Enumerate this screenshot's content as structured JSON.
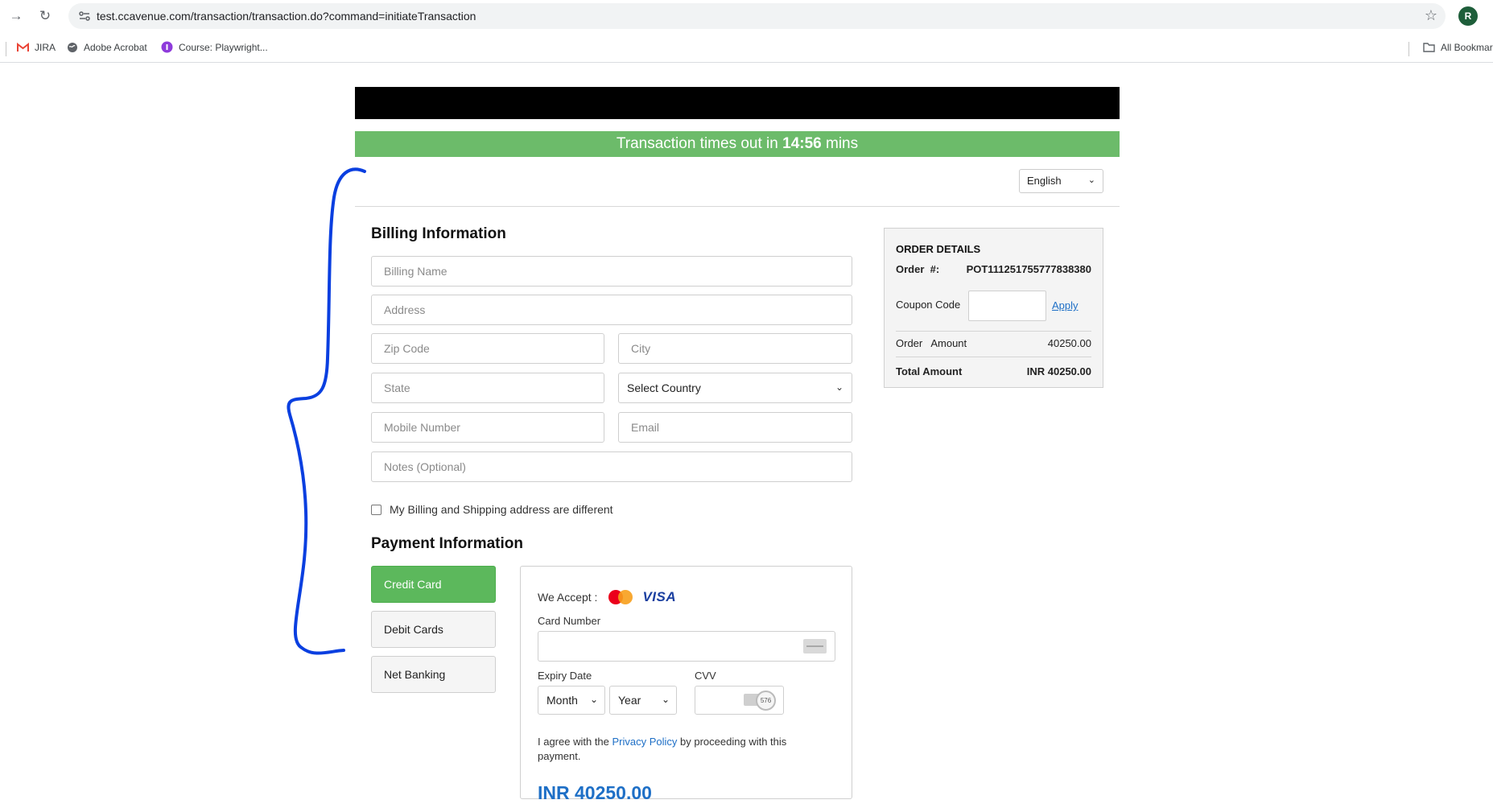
{
  "browser": {
    "url": "test.ccavenue.com/transaction/transaction.do?command=initiateTransaction",
    "profile_initial": "R",
    "bookmarks": [
      {
        "label": "JIRA",
        "icon": "gmail-icon"
      },
      {
        "label": "Adobe Acrobat",
        "icon": "globe-icon"
      },
      {
        "label": "Course: Playwright...",
        "icon": "course-icon"
      }
    ],
    "all_bookmarks_label": "All Bookmarks"
  },
  "timer": {
    "prefix": "Transaction times out in ",
    "time": "14:56",
    "suffix": " mins"
  },
  "language": {
    "selected": "English"
  },
  "billing": {
    "title": "Billing Information",
    "name_placeholder": "Billing Name",
    "address_placeholder": "Address",
    "zip_placeholder": "Zip Code",
    "city_placeholder": "City",
    "state_placeholder": "State",
    "country_selected": "Select Country",
    "mobile_placeholder": "Mobile Number",
    "email_placeholder": "Email",
    "notes_placeholder": "Notes (Optional)",
    "different_address_label": "My Billing and Shipping address are different"
  },
  "payment": {
    "title": "Payment Information",
    "tabs": [
      {
        "label": "Credit Card",
        "active": true
      },
      {
        "label": "Debit Cards",
        "active": false
      },
      {
        "label": "Net Banking",
        "active": false
      }
    ],
    "we_accept_label": "We Accept :",
    "visa_label": "VISA",
    "card_number_label": "Card Number",
    "expiry_label": "Expiry Date",
    "month_selected": "Month",
    "year_selected": "Year",
    "cvv_label": "CVV",
    "cvv_sample": "576",
    "agree_prefix": "I agree with the ",
    "privacy_link": "Privacy Policy",
    "agree_suffix": " by proceeding with this payment.",
    "amount": "INR 40250.00"
  },
  "order": {
    "title": "ORDER DETAILS",
    "order_no_label": "Order  #:",
    "order_no": "POT111251755777838380",
    "coupon_label": "Coupon Code",
    "apply_label": "Apply",
    "amount_label": "Order   Amount",
    "amount_value": "40250.00",
    "total_label": "Total Amount",
    "total_value": "INR 40250.00"
  },
  "colors": {
    "accent_green": "#5cb85c",
    "timer_green": "#6cbb6a",
    "link_blue": "#1e6fc6",
    "annotation_blue": "#0a3fe0"
  }
}
